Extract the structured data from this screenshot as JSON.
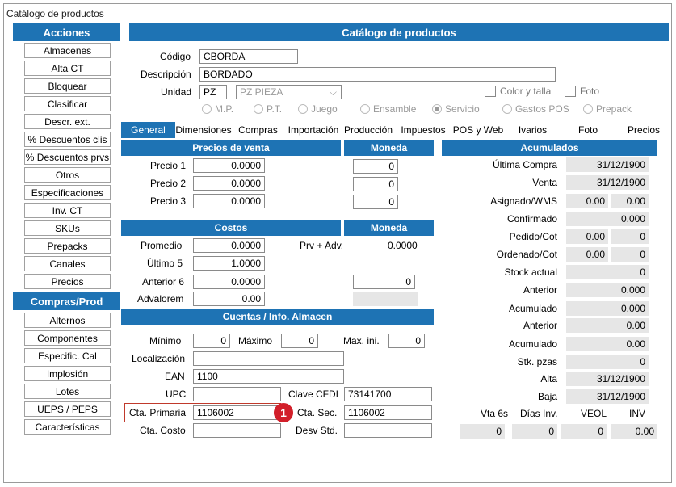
{
  "window_title": "Catálogo de productos",
  "sidebar": {
    "acciones_title": "Acciones",
    "acciones": [
      "Almacenes",
      "Alta CT",
      "Bloquear",
      "Clasificar",
      "Descr. ext.",
      "% Descuentos clis",
      "% Descuentos prvs",
      "Otros",
      "Especificaciones",
      "Inv. CT",
      "SKUs",
      "Prepacks",
      "Canales",
      "Precios"
    ],
    "compras_title": "Compras/Prod",
    "compras": [
      "Alternos",
      "Componentes",
      "Especific. Cal",
      "Implosión",
      "Lotes",
      "UEPS / PEPS",
      "Características"
    ]
  },
  "header": {
    "title": "Catálogo de productos",
    "codigo_label": "Código",
    "codigo_value": "CBORDA",
    "descripcion_label": "Descripción",
    "descripcion_value": "BORDADO",
    "unidad_label": "Unidad",
    "unidad_code": "PZ",
    "unidad_select": "PZ  PIEZA",
    "color_talla_label": "Color y talla",
    "foto_label": "Foto",
    "radios": [
      "M.P.",
      "P.T.",
      "Juego",
      "Ensamble",
      "Servicio",
      "Gastos POS",
      "Prepack"
    ],
    "radio_selected": "Servicio"
  },
  "tabs": [
    "General",
    "Dimensiones",
    "Compras",
    "Importación",
    "Producción",
    "Impuestos",
    "POS y Web",
    "Ivarios",
    "Foto",
    "Precios"
  ],
  "precios_venta": {
    "title": "Precios de venta",
    "moneda_title": "Moneda",
    "rows": [
      {
        "label": "Precio 1",
        "value": "0.0000",
        "moneda": "0"
      },
      {
        "label": "Precio 2",
        "value": "0.0000",
        "moneda": "0"
      },
      {
        "label": "Precio 3",
        "value": "0.0000",
        "moneda": "0"
      }
    ]
  },
  "costos": {
    "title": "Costos",
    "moneda_title": "Moneda",
    "promedio_label": "Promedio",
    "promedio_value": "0.0000",
    "prv_adv_label": "Prv + Adv.",
    "prv_adv_value": "0.0000",
    "ultimo_label": "Último 5",
    "ultimo_value": "1.0000",
    "anterior_label": "Anterior 6",
    "anterior_value": "0.0000",
    "anterior_moneda": "0",
    "advalorem_label": "Advalorem",
    "advalorem_value": "0.00"
  },
  "cuentas": {
    "title": "Cuentas / Info. Almacen",
    "minimo_label": "Mínimo",
    "minimo_value": "0",
    "maximo_label": "Máximo",
    "maximo_value": "0",
    "maxini_label": "Max. ini.",
    "maxini_value": "0",
    "localizacion_label": "Localización",
    "localizacion_value": "",
    "ean_label": "EAN",
    "ean_value": "1100",
    "upc_label": "UPC",
    "upc_value": "",
    "clave_cfdi_label": "Clave CFDI",
    "clave_cfdi_value": "73141700",
    "cta_primaria_label": "Cta. Primaria",
    "cta_primaria_value": "1106002",
    "cta_sec_label": "Cta. Sec.",
    "cta_sec_value": "1106002",
    "cta_costo_label": "Cta. Costo",
    "cta_costo_value": "",
    "desv_std_label": "Desv Std.",
    "desv_std_value": ""
  },
  "acumulados": {
    "title": "Acumulados",
    "ultima_compra_label": "Última  Compra",
    "ultima_compra_value": "31/12/1900",
    "venta_label": "Venta",
    "venta_value": "31/12/1900",
    "asignado_label": "Asignado/WMS",
    "asignado_a": "0.00",
    "asignado_b": "0.00",
    "confirmado_label": "Confirmado",
    "confirmado_value": "0.000",
    "pedido_label": "Pedido/Cot",
    "pedido_a": "0.00",
    "pedido_b": "0",
    "ordenado_label": "Ordenado/Cot",
    "ordenado_a": "0.00",
    "ordenado_b": "0",
    "stock_label": "Stock actual",
    "stock_value": "0",
    "anterior1_label": "Anterior",
    "anterior1_value": "0.000",
    "acumulado1_label": "Acumulado",
    "acumulado1_value": "0.000",
    "anterior2_label": "Anterior",
    "anterior2_value": "0.00",
    "acumulado2_label": "Acumulado",
    "acumulado2_value": "0.00",
    "stk_label": "Stk. pzas",
    "stk_value": "0",
    "alta_label": "Alta",
    "alta_value": "31/12/1900",
    "baja_label": "Baja",
    "baja_value": "31/12/1900",
    "vta6s_label": "Vta 6s",
    "vta6s_value": "0",
    "dias_label": "Días Inv.",
    "dias_value": "0",
    "veol_label": "VEOL",
    "veol_value": "0",
    "inv_label": "INV",
    "inv_value": "0.00"
  },
  "badge": "1",
  "colors": {
    "accent": "#1e73b4",
    "badge": "#d21f2a"
  }
}
